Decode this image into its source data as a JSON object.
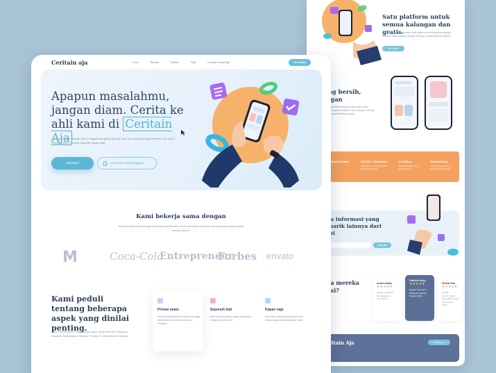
{
  "front": {
    "logo": "Ceritain aja",
    "nav": {
      "links": [
        "Home",
        "Service",
        "Product",
        "FAQ",
        "Contact Ceritain Aja"
      ],
      "cta": "Get Started"
    },
    "hero": {
      "title_line1": "Apapun masalahmu,",
      "title_line2": "jangan diam. Cerita ke",
      "title_line3_prefix": "ahli kami di ",
      "title_highlight": "Ceritain Aja",
      "description": "Curanya mudah banget, kamu tinggal menghubungi ahli kami dan buat perjanjian ketemu baik online maupun offline dimana saja dan kapan saja",
      "primary_button": "Download",
      "secondary_button": "Lihat video dari pengguna"
    },
    "partners": {
      "title": "Kami bekerja sama dengan",
      "description": "Kami bekerja sama dengan beberapa perusahaan untuk membantu mereka para karyawan yang sedang banyak pikiran.",
      "logos": [
        "M",
        "Coca-Cola",
        "Entrepreneur",
        "Forbes",
        "envato"
      ]
    },
    "care": {
      "title": "Kami peduli tentang beberapa aspek yang dinilai penting.",
      "description": "Kami menyediakan tempat untuk kalian untuk bercerita mengenai masalah hidup ataupun lainnya. Tenang, ini tidak disebar luaskan.",
      "features": [
        {
          "title": "Privasi aman",
          "desc": "Kami menghargai privasi anda, sehingga kami tidak akan membocorkan ke manapun"
        },
        {
          "title": "Sepenuh hati",
          "desc": "Kami mendengarkan setiap cerita anda dengan sepenuh hati"
        },
        {
          "title": "Kapan saja",
          "desc": "Kami siap melayani anda kapan pun dimana saja sesuai kebutuhan anda"
        }
      ]
    }
  },
  "back": {
    "hero_title": "Satu platform untuk semua kalangan dan gratis.",
    "hero_desc": "Kami menyediakan tempat untuk kalian untuk bercerita mengenai masalah hidup ataupun lainnya. Tenang, ini tidak disebar luaskan.",
    "hero_button": "Get Started",
    "design_title": "yang bersih, elegan",
    "design_title_prefix": "an",
    "stats": [
      {
        "title": "100,000 + Download",
        "desc": "Aplikasi kami sudah diunduh lebih dari 100.000"
      },
      {
        "title": "4.9 Rating",
        "desc": "Kami mendapat rating bagus di store"
      },
      {
        "title": "Social Rating",
        "desc": "Kami mendapat rating bagus di sosial media"
      }
    ],
    "stats_left": "Bisa download Gratis",
    "info_title": "tahu informasi yang menarik lainnya dari kami",
    "info_button": "Subscribe",
    "testimonial_title": "kata mereka kami?",
    "testimonials": [
      {
        "name": "Amani malika",
        "stars": "★★★★★",
        "text": "Sangat membantu dan pelayanan memuaskan"
      },
      {
        "name": "Fabricio Henry",
        "stars": "★★★★★",
        "text": "Sangat membantu ketika aku sedang banyak pikiran"
      },
      {
        "name": "Felicia Putri",
        "stars": "★★★★★",
        "text": "Sangat recommended untuk kalian yang butuh teman cerita"
      }
    ],
    "footer_logo": "Ceritain Aja",
    "footer_button": "Get Started"
  },
  "colors": {
    "accent": "#4bb5d3",
    "heading": "#2d3f5a",
    "orange": "#f4a15f",
    "navy": "#5e7198"
  }
}
